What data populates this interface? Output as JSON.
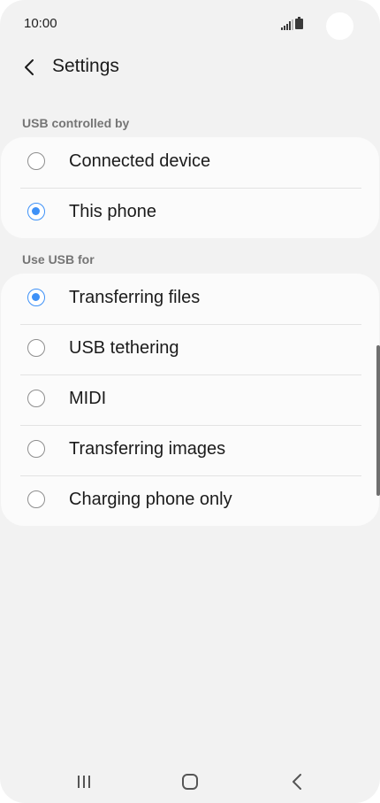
{
  "status_bar": {
    "time": "10:00",
    "icons": [
      "signal-icon",
      "battery-icon"
    ]
  },
  "header": {
    "back_icon": "chevron-left-icon",
    "title": "Settings"
  },
  "usb_controlled_by": {
    "title": "USB controlled by",
    "options": [
      {
        "label": "Connected device",
        "selected": false
      },
      {
        "label": "This phone",
        "selected": true
      }
    ]
  },
  "use_usb_for": {
    "title": "Use USB for",
    "options": [
      {
        "label": "Transferring files",
        "selected": true
      },
      {
        "label": "USB tethering",
        "selected": false
      },
      {
        "label": "MIDI",
        "selected": false
      },
      {
        "label": "Transferring images",
        "selected": false
      },
      {
        "label": "Charging phone only",
        "selected": false
      }
    ]
  },
  "nav_bar": {
    "buttons": [
      "recent-apps-icon",
      "home-icon",
      "back-icon"
    ]
  },
  "colors": {
    "accent": "#3e91f7",
    "background": "#f2f2f2",
    "card": "#fbfbfb"
  }
}
